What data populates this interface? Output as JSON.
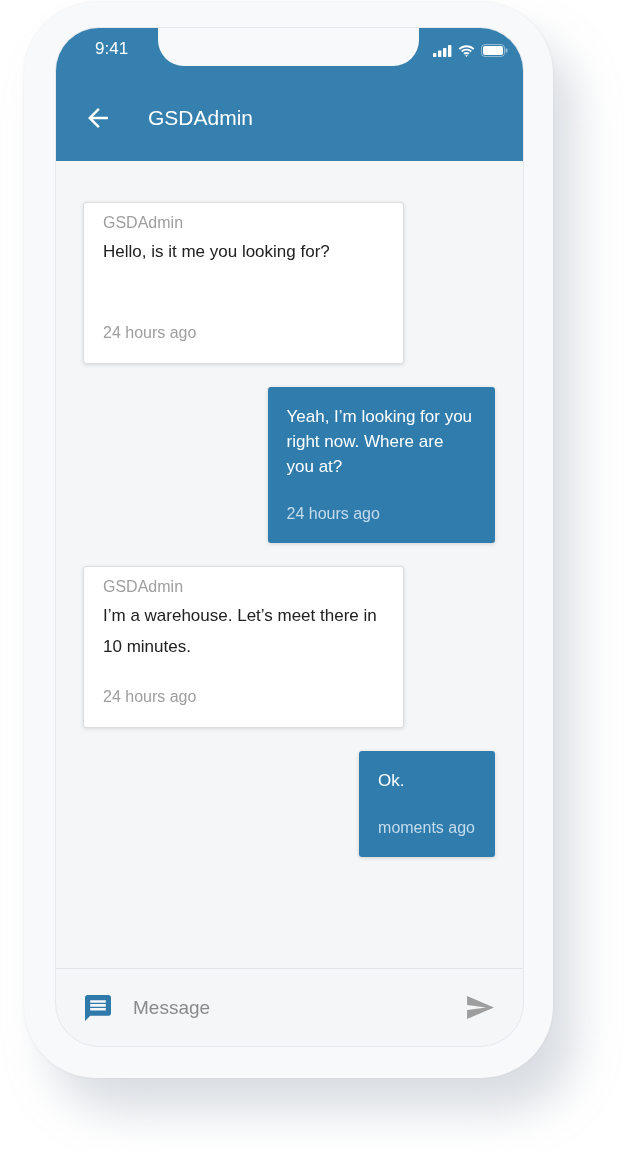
{
  "status_bar": {
    "time": "9:41"
  },
  "header": {
    "title": "GSDAdmin"
  },
  "messages": [
    {
      "kind": "incoming",
      "sender": "GSDAdmin",
      "text": "Hello, is it me you looking for?",
      "time": "24 hours ago"
    },
    {
      "kind": "outgoing",
      "text": "Yeah, I’m looking for you right now. Where are you at?",
      "time": "24 hours ago"
    },
    {
      "kind": "incoming",
      "sender": "GSDAdmin",
      "text": "I’m a warehouse. Let’s meet there in 10 minutes.",
      "time": "24 hours ago"
    },
    {
      "kind": "outgoing",
      "text": "Ok.",
      "time": "moments ago"
    }
  ],
  "composer": {
    "placeholder": "Message"
  }
}
